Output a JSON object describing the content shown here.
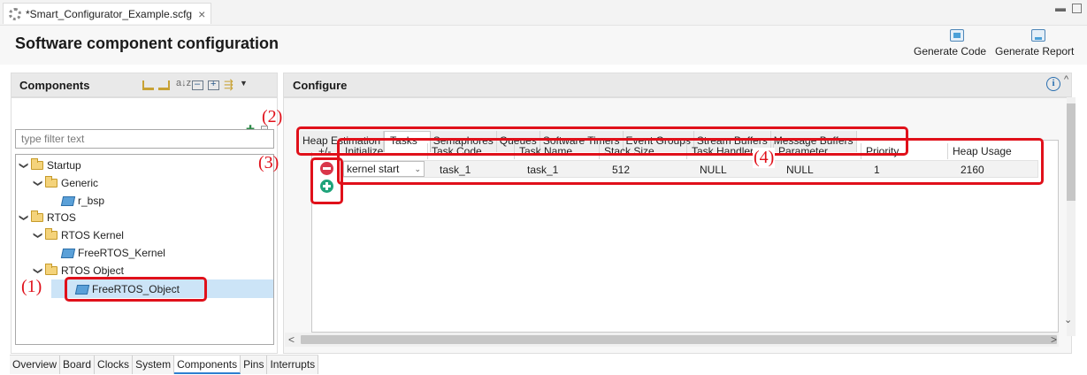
{
  "editor": {
    "tab_title": "*Smart_Configurator_Example.scfg",
    "close_glyph": "×",
    "win_min": "▭"
  },
  "page": {
    "title": "Software component configuration"
  },
  "toolbar": {
    "generate_code": "Generate Code",
    "generate_report": "Generate Report"
  },
  "components": {
    "title": "Components",
    "filter_placeholder": "type filter text",
    "sort_label": "a↓z",
    "tree": {
      "startup": "Startup",
      "generic": "Generic",
      "r_bsp": "r_bsp",
      "rtos": "RTOS",
      "rtos_kernel": "RTOS Kernel",
      "freertos_kernel": "FreeRTOS_Kernel",
      "rtos_object": "RTOS Object",
      "freertos_object": "FreeRTOS_Object"
    }
  },
  "configure": {
    "title": "Configure",
    "info": "i",
    "tabs": [
      "Heap Estimation",
      "Tasks",
      "Semaphores",
      "Queues",
      "Software Timers",
      "Event Groups",
      "Stream Buffers",
      "Message Buffers"
    ],
    "active_tab": "Tasks",
    "columns": [
      "+/-",
      "Initialize",
      "Task Code",
      "Task Name",
      "Stack Size",
      "Task Handler",
      "Parameter",
      "Priority",
      "Heap Usage"
    ],
    "row": {
      "initialize": "kernel start",
      "task_code": "task_1",
      "task_name": "task_1",
      "stack_size": "512",
      "task_handler": "NULL",
      "parameter": "NULL",
      "priority": "1",
      "heap_usage": "2160"
    }
  },
  "annotations": {
    "a1": "(1)",
    "a2": "(2)",
    "a3": "(3)",
    "a4": "(4)",
    "color": "#e0101a"
  },
  "bottom_tabs": [
    "Overview",
    "Board",
    "Clocks",
    "System",
    "Components",
    "Pins",
    "Interrupts"
  ],
  "bottom_active": "Components",
  "colors": {
    "selection": "#cce4f7",
    "remove": "#d9364a",
    "add": "#1fa37a",
    "folder": "#f4d37b"
  }
}
